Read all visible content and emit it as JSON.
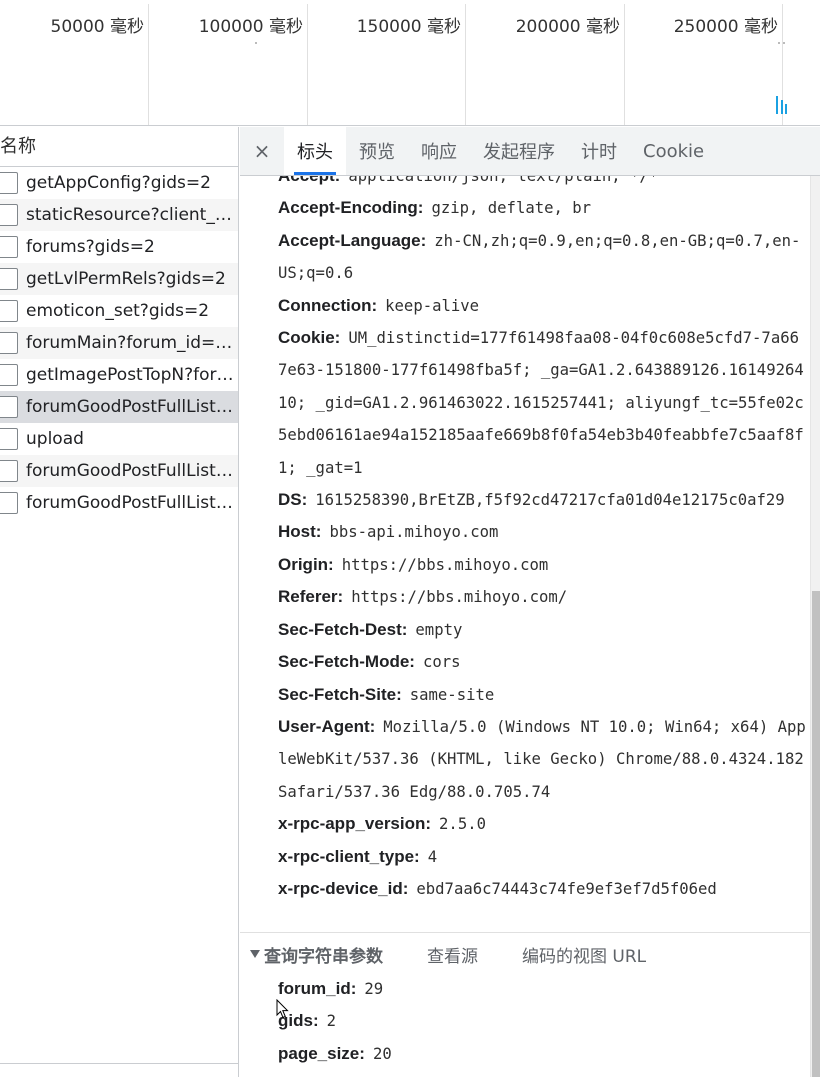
{
  "timeline": {
    "labels": [
      "50000 毫秒",
      "100000 毫秒",
      "150000 毫秒",
      "200000 毫秒",
      "250000 毫秒"
    ]
  },
  "list": {
    "header": "名称",
    "requests": [
      "getAppConfig?gids=2",
      "staticResource?client_ty...",
      "forums?gids=2",
      "getLvlPermRels?gids=2",
      "emoticon_set?gids=2",
      "forumMain?forum_id=2...",
      "getImagePostTopN?foru...",
      "forumGoodPostFullList?...",
      "upload",
      "forumGoodPostFullList?...",
      "forumGoodPostFullList?..."
    ]
  },
  "tabs": {
    "close": "×",
    "items": [
      "标头",
      "预览",
      "响应",
      "发起程序",
      "计时",
      "Cookie"
    ]
  },
  "headers": [
    {
      "k": "Accept:",
      "v": "application/json, text/plain, */*"
    },
    {
      "k": "Accept-Encoding:",
      "v": "gzip, deflate, br"
    },
    {
      "k": "Accept-Language:",
      "v": "zh-CN,zh;q=0.9,en;q=0.8,en-GB;q=0.7,en-US;q=0.6"
    },
    {
      "k": "Connection:",
      "v": "keep-alive"
    },
    {
      "k": "Cookie:",
      "v": "UM_distinctid=177f61498faa08-04f0c608e5cfd7-7a667e63-151800-177f61498fba5f; _ga=GA1.2.643889126.1614926410; _gid=GA1.2.961463022.1615257441; aliyungf_tc=55fe02c5ebd06161ae94a152185aafe669b8f0fa54eb3b40feabbfe7c5aaf8f1; _gat=1"
    },
    {
      "k": "DS:",
      "v": "1615258390,BrEtZB,f5f92cd47217cfa01d04e12175c0af29"
    },
    {
      "k": "Host:",
      "v": "bbs-api.mihoyo.com"
    },
    {
      "k": "Origin:",
      "v": "https://bbs.mihoyo.com"
    },
    {
      "k": "Referer:",
      "v": "https://bbs.mihoyo.com/"
    },
    {
      "k": "Sec-Fetch-Dest:",
      "v": "empty"
    },
    {
      "k": "Sec-Fetch-Mode:",
      "v": "cors"
    },
    {
      "k": "Sec-Fetch-Site:",
      "v": "same-site"
    },
    {
      "k": "User-Agent:",
      "v": "Mozilla/5.0 (Windows NT 10.0; Win64; x64) AppleWebKit/537.36 (KHTML, like Gecko) Chrome/88.0.4324.182 Safari/537.36 Edg/88.0.705.74"
    },
    {
      "k": "x-rpc-app_version:",
      "v": "2.5.0"
    },
    {
      "k": "x-rpc-client_type:",
      "v": "4"
    },
    {
      "k": "x-rpc-device_id:",
      "v": "ebd7aa6c74443c74fe9ef3ef7d5f06ed"
    }
  ],
  "query_section": {
    "title": "查询字符串参数",
    "view_source": "查看源",
    "view_encoded": "编码的视图 URL"
  },
  "params": [
    {
      "k": "forum_id:",
      "v": "29"
    },
    {
      "k": "gids:",
      "v": "2"
    },
    {
      "k": "page_size:",
      "v": "20"
    }
  ]
}
